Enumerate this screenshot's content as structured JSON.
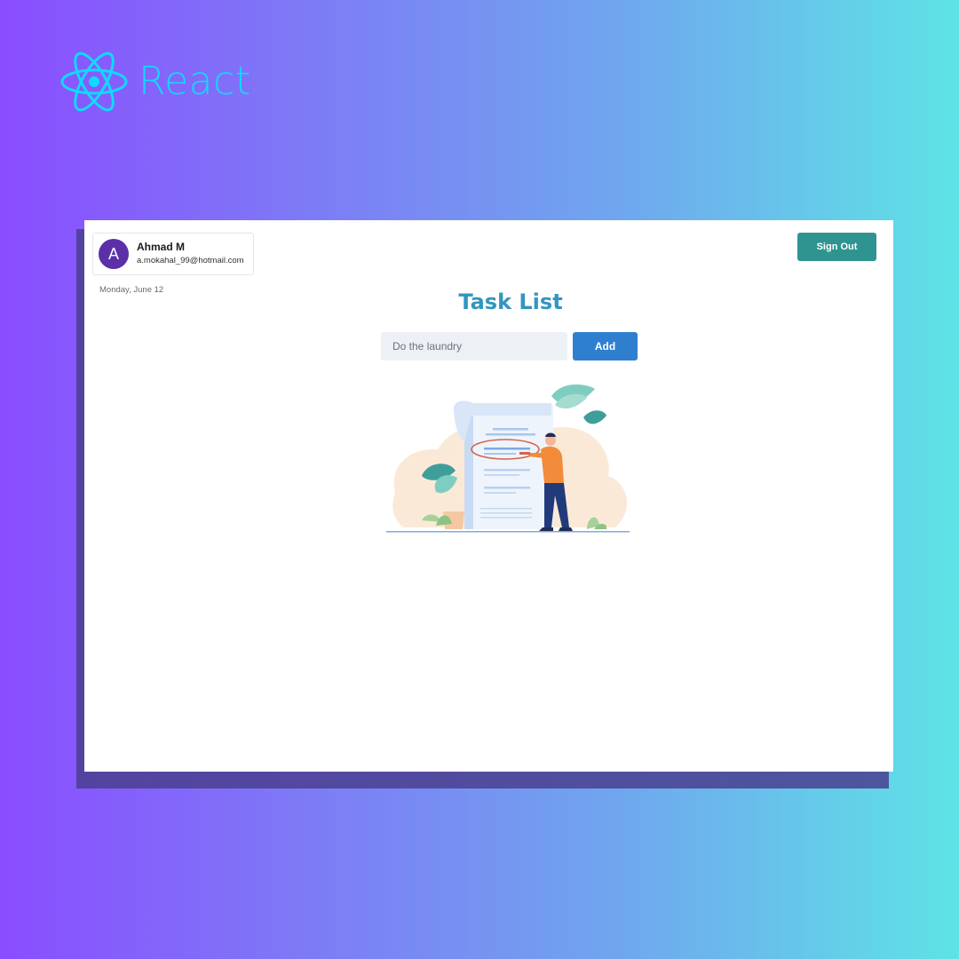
{
  "brand": {
    "name": "React",
    "icon": "react-atom-icon",
    "color": "#11d9ff"
  },
  "user": {
    "avatar_letter": "A",
    "name": "Ahmad M",
    "email": "a.mokahal_99@hotmail.com",
    "avatar_color": "#5a2fa8"
  },
  "date": "Monday, June 12",
  "header": {
    "signout_label": "Sign Out",
    "signout_color": "#2f9490"
  },
  "main": {
    "title": "Task List",
    "input_placeholder": "Do the laundry",
    "input_value": "",
    "add_label": "Add",
    "add_color": "#2f7fd0",
    "illustration": "task-list-illustration"
  }
}
